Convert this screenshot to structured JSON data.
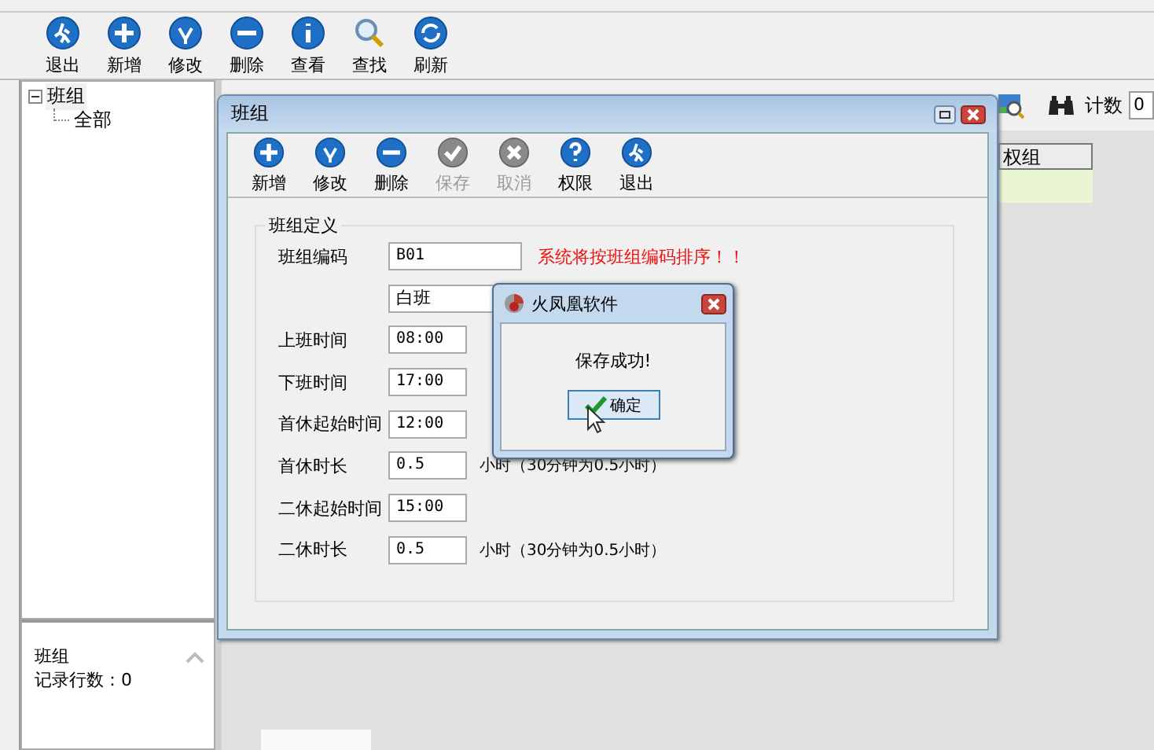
{
  "main_toolbar": [
    {
      "kind": "exit",
      "label": "退出"
    },
    {
      "kind": "add",
      "label": "新增"
    },
    {
      "kind": "edit",
      "label": "修改"
    },
    {
      "kind": "delete",
      "label": "删除"
    },
    {
      "kind": "view",
      "label": "查看"
    },
    {
      "kind": "find",
      "label": "查找"
    },
    {
      "kind": "refresh",
      "label": "刷新"
    }
  ],
  "tree": {
    "items": [
      {
        "label": "班组",
        "expanded": true,
        "children": [
          {
            "label": "全部"
          }
        ]
      }
    ]
  },
  "info_panel": {
    "title": "班组",
    "record_count": "记录行数：0"
  },
  "right_toolbar": {
    "count_label": "计数",
    "count_value": "0"
  },
  "grid": {
    "columns": [
      "权组"
    ]
  },
  "dialog": {
    "title": "班组",
    "toolbar": [
      {
        "kind": "add",
        "label": "新增",
        "disabled": false
      },
      {
        "kind": "edit",
        "label": "修改",
        "disabled": false
      },
      {
        "kind": "delete",
        "label": "删除",
        "disabled": false
      },
      {
        "kind": "save",
        "label": "保存",
        "disabled": true
      },
      {
        "kind": "cancel",
        "label": "取消",
        "disabled": true
      },
      {
        "kind": "help",
        "label": "权限",
        "disabled": false
      },
      {
        "kind": "exit",
        "label": "退出",
        "disabled": false
      }
    ],
    "group_title": "班组定义",
    "fields": [
      {
        "kind": "code",
        "label": "班组编码",
        "value": "B01",
        "note": "系统将按班组编码排序！！"
      },
      {
        "kind": "name",
        "value": "白班"
      },
      {
        "kind": "time",
        "label": "上班时间",
        "value": "08:00"
      },
      {
        "kind": "time",
        "label": "下班时间",
        "value": "17:00"
      },
      {
        "kind": "time",
        "label": "首休起始时间",
        "value": "12:00"
      },
      {
        "kind": "time",
        "label": "首休时长",
        "value": "0.5",
        "note": "小时（30分钟为0.5小时）"
      },
      {
        "kind": "time",
        "label": "二休起始时间",
        "value": "15:00"
      },
      {
        "kind": "time",
        "label": "二休时长",
        "value": "0.5",
        "note": "小时（30分钟为0.5小时）"
      }
    ]
  },
  "message_box": {
    "title": "火凤凰软件",
    "message": "保存成功!",
    "button": "确定"
  }
}
